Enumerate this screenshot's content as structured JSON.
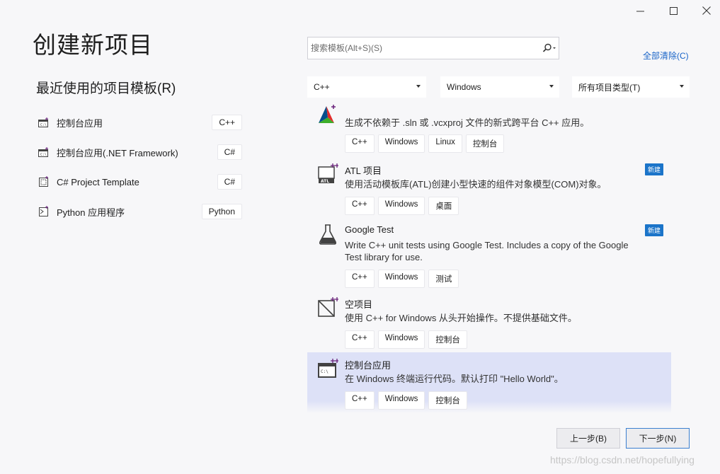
{
  "header": {
    "title": "创建新项目"
  },
  "recent": {
    "title": "最近使用的项目模板(R)",
    "items": [
      {
        "label": "控制台应用",
        "tag": "C++",
        "icon": "console-app-icon"
      },
      {
        "label": "控制台应用(.NET Framework)",
        "tag": "C#",
        "icon": "console-app-icon"
      },
      {
        "label": "C# Project Template",
        "tag": "C#",
        "icon": "project-template-icon"
      },
      {
        "label": "Python 应用程序",
        "tag": "Python",
        "icon": "python-app-icon"
      }
    ]
  },
  "search": {
    "placeholder": "搜索模板(Alt+S)(S)"
  },
  "filters": {
    "clear_label": "全部清除(C)",
    "language": "C++",
    "platform": "Windows",
    "project_type": "所有项目类型(T)"
  },
  "templates": [
    {
      "name": "",
      "desc": "生成不依赖于 .sln 或 .vcxproj 文件的新式跨平台 C++ 应用。",
      "tags": [
        "C++",
        "Windows",
        "Linux",
        "控制台"
      ],
      "icon": "cmake-icon",
      "badge": ""
    },
    {
      "name": "ATL 项目",
      "desc": "使用活动模板库(ATL)创建小型快速的组件对象模型(COM)对象。",
      "tags": [
        "C++",
        "Windows",
        "桌面"
      ],
      "icon": "atl-icon",
      "badge": "新建"
    },
    {
      "name": "Google Test",
      "desc": "Write C++ unit tests using Google Test. Includes a copy of the Google Test library for use.",
      "tags": [
        "C++",
        "Windows",
        "测试"
      ],
      "icon": "flask-icon",
      "badge": "新建"
    },
    {
      "name": "空项目",
      "desc": "使用 C++ for Windows 从头开始操作。不提供基础文件。",
      "tags": [
        "C++",
        "Windows",
        "控制台"
      ],
      "icon": "empty-project-icon",
      "badge": ""
    },
    {
      "name": "控制台应用",
      "desc": "在 Windows 终端运行代码。默认打印 \"Hello World\"。",
      "tags": [
        "C++",
        "Windows",
        "控制台"
      ],
      "icon": "console-app-icon",
      "badge": ""
    }
  ],
  "footer": {
    "back_label": "上一步(B)",
    "next_label": "下一步(N)"
  },
  "watermark": "https://blog.csdn.net/hopefullying",
  "colors": {
    "accent": "#1b74c9",
    "selected_bg": "#dde1f7",
    "window_bg": "#f7f7f9"
  }
}
